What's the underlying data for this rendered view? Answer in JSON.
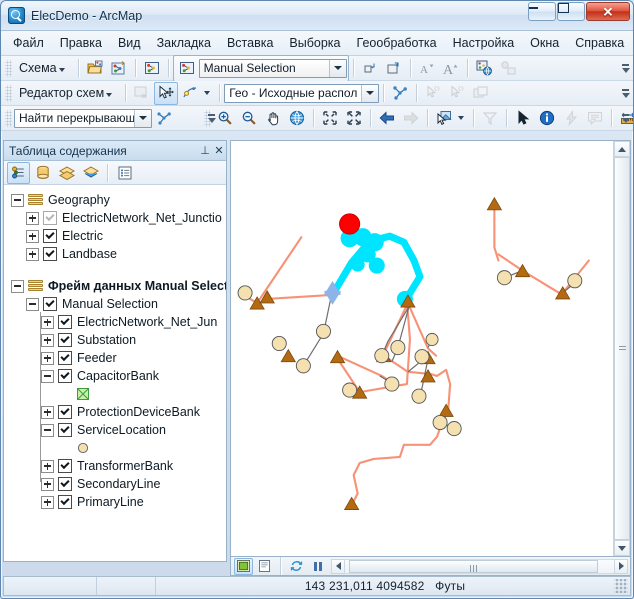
{
  "window": {
    "title": "ElecDemo - ArcMap",
    "app_icon": "magnifier-globe-icon",
    "minimize": "–",
    "maximize": "□",
    "close": "✕"
  },
  "menu": {
    "items": [
      {
        "label": "Файл",
        "name": "menu-file"
      },
      {
        "label": "Правка",
        "name": "menu-edit"
      },
      {
        "label": "Вид",
        "name": "menu-view"
      },
      {
        "label": "Закладка",
        "name": "menu-bookmarks"
      },
      {
        "label": "Вставка",
        "name": "menu-insert"
      },
      {
        "label": "Выборка",
        "name": "menu-selection"
      },
      {
        "label": "Геообработка",
        "name": "menu-geoprocessing"
      },
      {
        "label": "Настройка",
        "name": "menu-customize"
      },
      {
        "label": "Окна",
        "name": "menu-windows"
      },
      {
        "label": "Справка",
        "name": "menu-help"
      }
    ]
  },
  "toolbar_schematic": {
    "menu_label": "Схема",
    "selection_combo": "Manual Selection",
    "buttons": [
      {
        "name": "open-diagram-icon"
      },
      {
        "name": "new-diagram-icon"
      },
      {
        "name": "diagram-list-icon"
      },
      {
        "name": "shrink-symbols-icon"
      },
      {
        "name": "enlarge-symbols-icon"
      },
      {
        "name": "decrease-font-icon"
      },
      {
        "name": "increase-font-icon"
      },
      {
        "name": "overlay-diagram-icon"
      },
      {
        "name": "diagram-properties-icon"
      }
    ]
  },
  "toolbar_editor": {
    "menu_label": "Редактор схем",
    "layout_combo": "Гео - Исходные распол",
    "buttons": [
      {
        "name": "clear-selection-icon"
      },
      {
        "name": "move-node-icon"
      },
      {
        "name": "edit-vertex-icon"
      },
      {
        "name": "network-layout-icon"
      },
      {
        "name": "select-node-icon"
      },
      {
        "name": "select-edge-icon"
      },
      {
        "name": "diagram-window-icon"
      }
    ]
  },
  "toolbar_tools": {
    "find_combo": "Найти перекрывающи",
    "buttons": [
      {
        "name": "trace-network-icon"
      },
      {
        "name": "zoom-in-icon"
      },
      {
        "name": "zoom-out-icon"
      },
      {
        "name": "pan-icon"
      },
      {
        "name": "full-extent-icon"
      },
      {
        "name": "fixed-zoom-in-icon"
      },
      {
        "name": "fixed-zoom-out-icon"
      },
      {
        "name": "previous-extent-icon"
      },
      {
        "name": "next-extent-icon"
      },
      {
        "name": "select-features-icon"
      },
      {
        "name": "clear-selected-icon"
      },
      {
        "name": "select-elements-icon"
      },
      {
        "name": "identify-icon"
      },
      {
        "name": "hyperlink-icon"
      },
      {
        "name": "html-popup-icon"
      },
      {
        "name": "measure-icon"
      }
    ]
  },
  "toc": {
    "title": "Таблица содержания",
    "pin": "⊥",
    "close": "✕",
    "view_buttons": [
      {
        "name": "list-by-drawing-order-icon"
      },
      {
        "name": "list-by-source-icon"
      },
      {
        "name": "list-by-visibility-icon"
      },
      {
        "name": "list-by-selection-icon"
      },
      {
        "name": "toc-options-icon"
      }
    ],
    "tree": [
      {
        "label": "Geography",
        "level": 1,
        "type": "dataframe",
        "expander": "minus",
        "bold": false
      },
      {
        "label": "ElectricNetwork_Net_Junctio",
        "level": 2,
        "type": "layer",
        "expander": "plus",
        "checked": "gray"
      },
      {
        "label": "Electric",
        "level": 2,
        "type": "layer",
        "expander": "plus",
        "checked": "yes"
      },
      {
        "label": "Landbase",
        "level": 2,
        "type": "layer",
        "expander": "plus",
        "checked": "yes"
      },
      {
        "label": "Фрейм данных Manual Select",
        "level": 1,
        "type": "dataframe",
        "expander": "minus",
        "bold": true
      },
      {
        "label": "Manual Selection",
        "level": 2,
        "type": "group",
        "expander": "minus",
        "checked": "yes"
      },
      {
        "label": "ElectricNetwork_Net_Jun",
        "level": 3,
        "type": "layer",
        "expander": "plus",
        "checked": "yes"
      },
      {
        "label": "Substation",
        "level": 3,
        "type": "layer",
        "expander": "plus",
        "checked": "yes"
      },
      {
        "label": "Feeder",
        "level": 3,
        "type": "layer",
        "expander": "plus",
        "checked": "yes"
      },
      {
        "label": "CapacitorBank",
        "level": 3,
        "type": "layer",
        "expander": "minus",
        "checked": "yes"
      },
      {
        "label": "",
        "level": 4,
        "type": "symbol",
        "symbol": "green-x-square"
      },
      {
        "label": "ProtectionDeviceBank",
        "level": 3,
        "type": "layer",
        "expander": "plus",
        "checked": "yes"
      },
      {
        "label": "ServiceLocation",
        "level": 3,
        "type": "layer",
        "expander": "minus",
        "checked": "yes"
      },
      {
        "label": "",
        "level": 4,
        "type": "symbol",
        "symbol": "tan-circle"
      },
      {
        "label": "TransformerBank",
        "level": 3,
        "type": "layer",
        "expander": "plus",
        "checked": "yes"
      },
      {
        "label": "SecondaryLine",
        "level": 3,
        "type": "layer",
        "expander": "plus",
        "checked": "yes"
      },
      {
        "label": "PrimaryLine",
        "level": 3,
        "type": "layer",
        "expander": "plus",
        "checked": "yes"
      }
    ]
  },
  "map": {
    "bottom_buttons": [
      {
        "name": "data-view-icon"
      },
      {
        "name": "layout-view-icon"
      },
      {
        "name": "refresh-view-icon"
      },
      {
        "name": "pause-drawing-icon"
      }
    ],
    "colors": {
      "primary_line": "#F79277",
      "secondary_line": "#6E6E6E",
      "selected": "#00E5FF",
      "transformer": "#B36A12",
      "service_location": "#F5E0B0",
      "substation": "#8CB4E8",
      "capacitor": "#FF0000"
    }
  },
  "status": {
    "coordinates": "143 231,011  4094582",
    "units": "Футы"
  }
}
